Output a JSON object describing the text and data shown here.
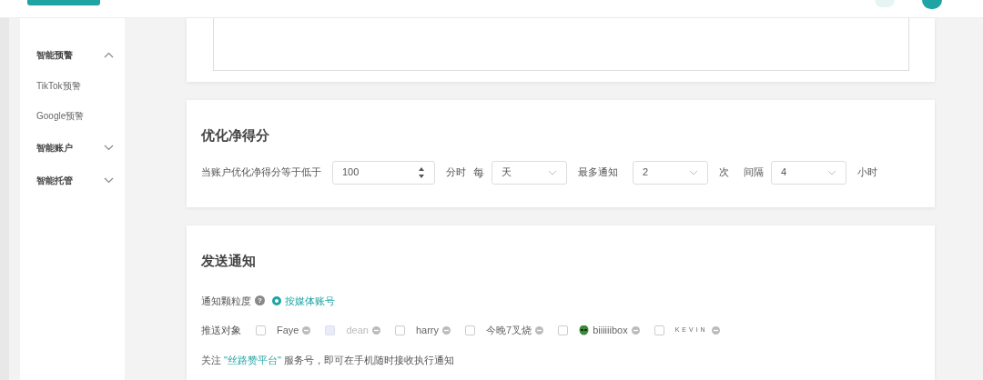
{
  "sidebar": {
    "items": [
      {
        "label": "智能预警",
        "expanded": true,
        "children": [
          {
            "label": "TikTok预警"
          },
          {
            "label": "Google预警"
          }
        ]
      },
      {
        "label": "智能账户",
        "expanded": false
      },
      {
        "label": "智能托管",
        "expanded": false
      }
    ]
  },
  "score_section": {
    "title": "优化净得分",
    "prefix": "当账户优化净得分等于低于",
    "score": "100",
    "unit": "分时",
    "every_label": "每",
    "period": "天",
    "max_label": "最多通知",
    "max_count": "2",
    "times_label": "次",
    "interval_label": "间隔",
    "interval": "4",
    "hours_label": "小时"
  },
  "notify_section": {
    "title": "发送通知",
    "granularity_label": "通知颗粒度",
    "help_icon": "?",
    "granularity_options": [
      {
        "label": "按媒体账号",
        "selected": true
      }
    ],
    "recipients_label": "推送对象",
    "recipients": [
      {
        "name": "Faye",
        "checked": false,
        "disabled": false,
        "kind": "plain"
      },
      {
        "name": "dean",
        "checked": false,
        "disabled": true,
        "kind": "plain"
      },
      {
        "name": "harry",
        "checked": false,
        "disabled": false,
        "kind": "plain"
      },
      {
        "name": "今晚7叉烧",
        "checked": false,
        "disabled": false,
        "kind": "plain"
      },
      {
        "name": "biiiiiibox",
        "checked": false,
        "disabled": false,
        "kind": "avatar"
      },
      {
        "name": "KEVIN",
        "checked": false,
        "disabled": false,
        "kind": "spaced"
      }
    ],
    "follow_before": "关注 ",
    "follow_link": "\"丝路赞平台\"",
    "follow_after": " 服务号，即可在手机随时接收执行通知"
  }
}
